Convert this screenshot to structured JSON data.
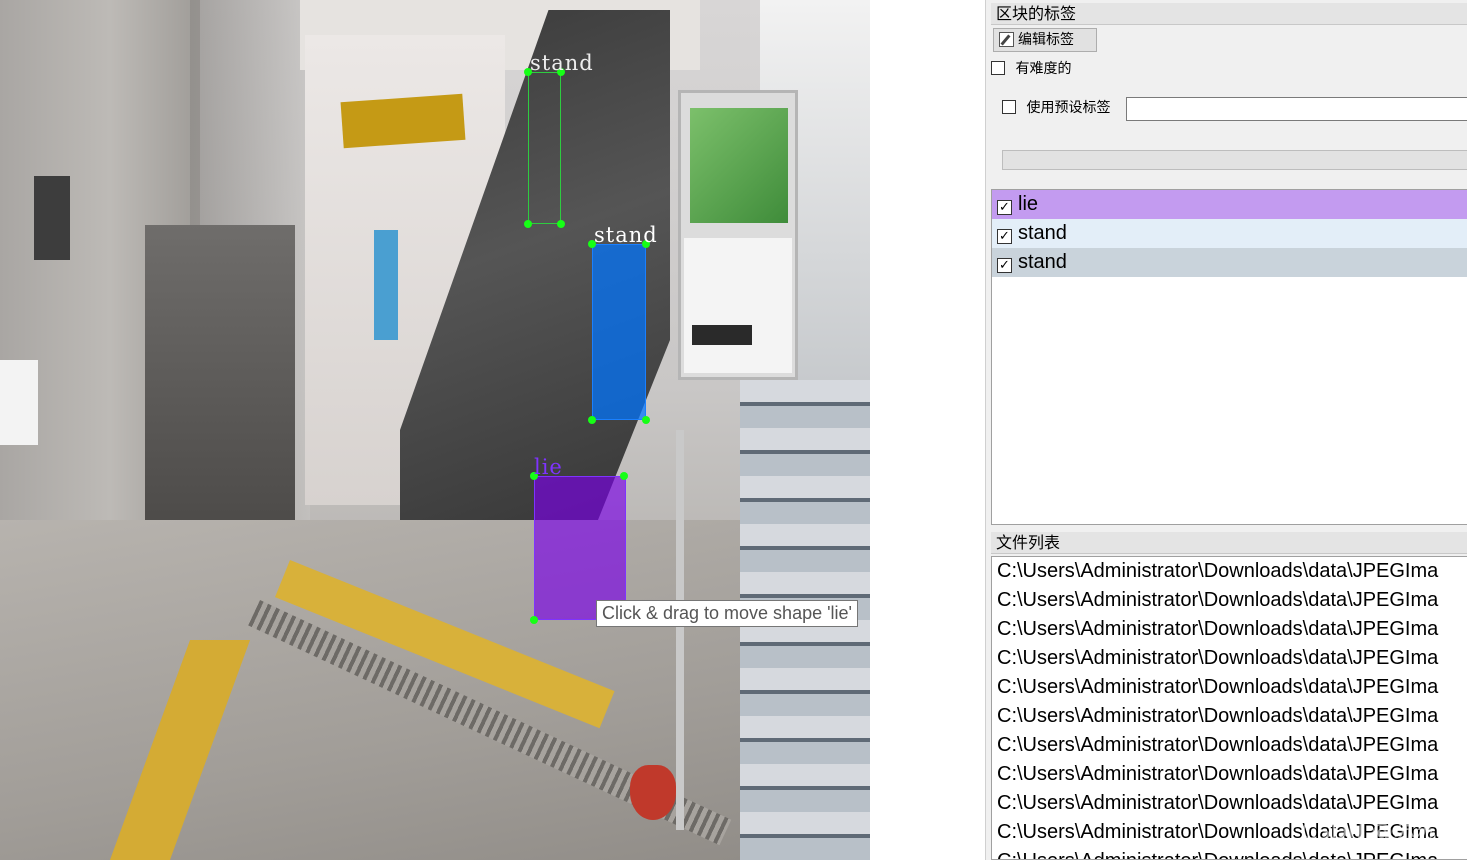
{
  "canvas": {
    "tooltip": "Click & drag to move shape 'lie'",
    "shapes": [
      {
        "label": "stand",
        "color": "#2ecc40"
      },
      {
        "label": "stand",
        "color": "#0074ff"
      },
      {
        "label": "lie",
        "color": "#7a00e6"
      }
    ]
  },
  "dock": {
    "box_labels_title": "区块的标签",
    "edit_label_button": "编辑标签",
    "difficult_label": "有难度的",
    "use_default_label": "使用预设标签",
    "default_label_value": "",
    "labels": [
      {
        "name": "lie",
        "checked": true,
        "highlight": "#c39bf0"
      },
      {
        "name": "stand",
        "checked": true,
        "highlight": "#e3eef8"
      },
      {
        "name": "stand",
        "checked": true,
        "highlight": "#c9d3db"
      }
    ],
    "file_list_title": "文件列表",
    "files": [
      "C:\\Users\\Administrator\\Downloads\\data\\JPEGIma",
      "C:\\Users\\Administrator\\Downloads\\data\\JPEGIma",
      "C:\\Users\\Administrator\\Downloads\\data\\JPEGIma",
      "C:\\Users\\Administrator\\Downloads\\data\\JPEGIma",
      "C:\\Users\\Administrator\\Downloads\\data\\JPEGIma",
      "C:\\Users\\Administrator\\Downloads\\data\\JPEGIma",
      "C:\\Users\\Administrator\\Downloads\\data\\JPEGIma",
      "C:\\Users\\Administrator\\Downloads\\data\\JPEGIma",
      "C:\\Users\\Administrator\\Downloads\\data\\JPEGIma",
      "C:\\Users\\Administrator\\Downloads\\data\\JPEGIma",
      "C:\\Users\\Administrator\\Downloads\\data\\JPEGIma"
    ],
    "watermark": "CSDN @苏苏哒"
  }
}
